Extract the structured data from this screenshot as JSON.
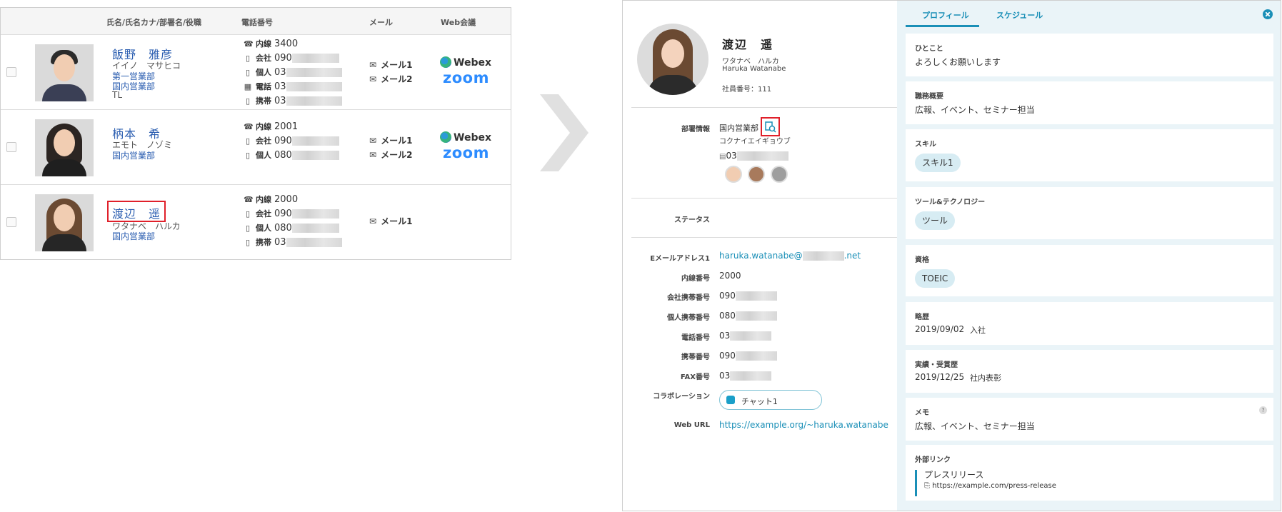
{
  "directory": {
    "headers": {
      "name": "氏名/氏名カナ/部署名/役職",
      "phone": "電話番号",
      "mail": "メール",
      "web": "Web会議"
    },
    "rows": [
      {
        "name": "飯野　雅彦",
        "kana": "イイノ　マサヒコ",
        "dept1": "第一営業部",
        "dept2": "国内営業部",
        "role": "TL",
        "phones": [
          {
            "icon": "phone-icon",
            "label": "内線",
            "value": "3400"
          },
          {
            "icon": "mobile-icon",
            "label": "会社",
            "value": "090"
          },
          {
            "icon": "mobile-icon",
            "label": "個人",
            "value": "03"
          },
          {
            "icon": "fax-icon",
            "label": "電話",
            "value": "03"
          },
          {
            "icon": "mobile-icon",
            "label": "携帯",
            "value": "03"
          }
        ],
        "mails": [
          "メール1",
          "メール2"
        ],
        "web": [
          "Webex",
          "zoom"
        ]
      },
      {
        "name": "柄本　希",
        "kana": "エモト　ノゾミ",
        "dept1": "国内営業部",
        "phones": [
          {
            "icon": "phone-icon",
            "label": "内線",
            "value": "2001"
          },
          {
            "icon": "mobile-icon",
            "label": "会社",
            "value": "090"
          },
          {
            "icon": "mobile-icon",
            "label": "個人",
            "value": "080"
          }
        ],
        "mails": [
          "メール1",
          "メール2"
        ],
        "web": [
          "Webex",
          "zoom"
        ]
      },
      {
        "name": "渡辺　遥",
        "kana": "ワタナベ　ハルカ",
        "dept1": "国内営業部",
        "phones": [
          {
            "icon": "phone-icon",
            "label": "内線",
            "value": "2000"
          },
          {
            "icon": "mobile-icon",
            "label": "会社",
            "value": "090"
          },
          {
            "icon": "mobile-icon",
            "label": "個人",
            "value": "080"
          },
          {
            "icon": "mobile-icon",
            "label": "携帯",
            "value": "03"
          }
        ],
        "mails": [
          "メール1"
        ]
      }
    ]
  },
  "profile": {
    "name": "渡辺　遥",
    "kana": "ワタナベ　ハルカ",
    "romaji": "Haruka Watanabe",
    "employee_no": "社員番号：111",
    "dept_label": "部署情報",
    "dept_name": "国内営業部",
    "dept_kana": "コクナイエイギョウブ",
    "dept_phone": "03",
    "status_label": "ステータス",
    "fields": {
      "email_label": "Eメールアドレス1",
      "email_user": "haruka.watanabe@",
      "email_domain": ".net",
      "ext_label": "内線番号",
      "ext_value": "2000",
      "company_mobile_label": "会社携帯番号",
      "company_mobile_value": "090",
      "personal_mobile_label": "個人携帯番号",
      "personal_mobile_value": "080",
      "tel_label": "電話番号",
      "tel_value": "03",
      "mobile_label": "携帯番号",
      "mobile_value": "090",
      "fax_label": "FAX番号",
      "fax_value": "03",
      "collab_label": "コラボレーション",
      "collab_value": "チャット1",
      "weburl_label": "Web URL",
      "weburl_value": "https://example.org/~haruka.watanabe"
    }
  },
  "tabs": {
    "profile": "プロフィール",
    "schedule": "スケジュール"
  },
  "cards": {
    "greeting_title": "ひとこと",
    "greeting_value": "よろしくお願いします",
    "duty_title": "職務概要",
    "duty_value": "広報、イベント、セミナー担当",
    "skill_title": "スキル",
    "skill_value": "スキル1",
    "tool_title": "ツール&テクノロジー",
    "tool_value": "ツール",
    "cert_title": "資格",
    "cert_value": "TOEIC",
    "history_title": "略歴",
    "history_date": "2019/09/02",
    "history_value": "入社",
    "award_title": "実績・受賞歴",
    "award_date": "2019/12/25",
    "award_value": "社内表彰",
    "memo_title": "メモ",
    "memo_value": "広報、イベント、セミナー担当",
    "memo_help": "?",
    "link_title": "外部リンク",
    "link_name": "プレスリリース",
    "link_url": "https://example.com/press-release"
  },
  "colors": {
    "accent": "#1a8fb7",
    "name_link": "#2a5db0",
    "highlight": "#e0202a",
    "right_bg": "#eaf4f8"
  }
}
